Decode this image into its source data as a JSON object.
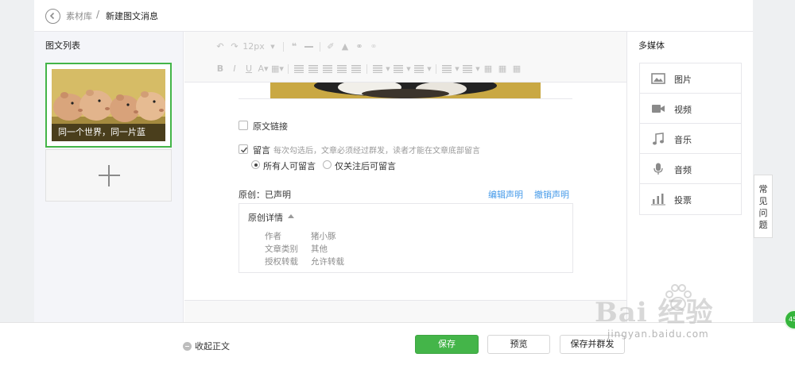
{
  "header": {
    "breadcrumb_root": "素材库",
    "breadcrumb_separator": "/",
    "breadcrumb_current": "新建图文消息"
  },
  "article_list": {
    "title": "图文列表",
    "articles": [
      {
        "caption": "同一个世界，同一片蓝"
      }
    ],
    "add_icon": "plus-icon"
  },
  "toolbar": {
    "font_size": "12px",
    "row1_icons": [
      "undo-icon",
      "redo-icon",
      "font-size-dropdown",
      "quote-icon",
      "horizontal-rule-icon",
      "format-brush-icon",
      "clear-format-icon",
      "link-icon",
      "unlink-icon"
    ],
    "row2_icons": [
      "bold-icon",
      "italic-icon",
      "underline-icon",
      "font-color-icon",
      "background-color-icon",
      "indent-icon",
      "align-left-icon",
      "align-center-icon",
      "align-right-icon",
      "align-justify-icon",
      "line-spacing-icon",
      "paragraph-spacing-icon",
      "letter-spacing-icon",
      "list-icon",
      "ordered-list-icon",
      "table-icon",
      "table-merge-icon",
      "table-split-icon"
    ]
  },
  "options": {
    "original_link_label": "原文链接",
    "original_link_checked": false,
    "comment_label": "留言",
    "comment_checked": true,
    "comment_hint": "每次勾选后，文章必须经过群发，读者才能在文章底部留言",
    "comment_scope": {
      "all_label": "所有人可留言",
      "followers_label": "仅关注后可留言",
      "selected": "all"
    }
  },
  "originality": {
    "title": "原创：已声明",
    "edit_link": "编辑声明",
    "cancel_link": "撤销声明",
    "details_title": "原创详情",
    "details": [
      {
        "key": "作者",
        "value": "猪小豚"
      },
      {
        "key": "文章类别",
        "value": "其他"
      },
      {
        "key": "授权转载",
        "value": "允许转载"
      }
    ]
  },
  "media": {
    "title": "多媒体",
    "items": [
      {
        "label": "图片",
        "icon": "image-icon"
      },
      {
        "label": "视频",
        "icon": "video-icon"
      },
      {
        "label": "音乐",
        "icon": "music-icon"
      },
      {
        "label": "音频",
        "icon": "microphone-icon"
      },
      {
        "label": "投票",
        "icon": "vote-icon"
      }
    ]
  },
  "faq_tab": {
    "chars": [
      "常",
      "见",
      "问",
      "题"
    ]
  },
  "footer": {
    "collapse_label": "收起正文",
    "save_label": "保存",
    "preview_label": "预览",
    "save_publish_label": "保存并群发"
  },
  "watermark": {
    "logo": "Bai  经验",
    "url": "jingyan.baidu.com"
  },
  "side_badge": {
    "text": "45"
  },
  "colors": {
    "primary_green": "#44b549",
    "link_blue": "#459ae9",
    "border": "#e7e7eb"
  }
}
